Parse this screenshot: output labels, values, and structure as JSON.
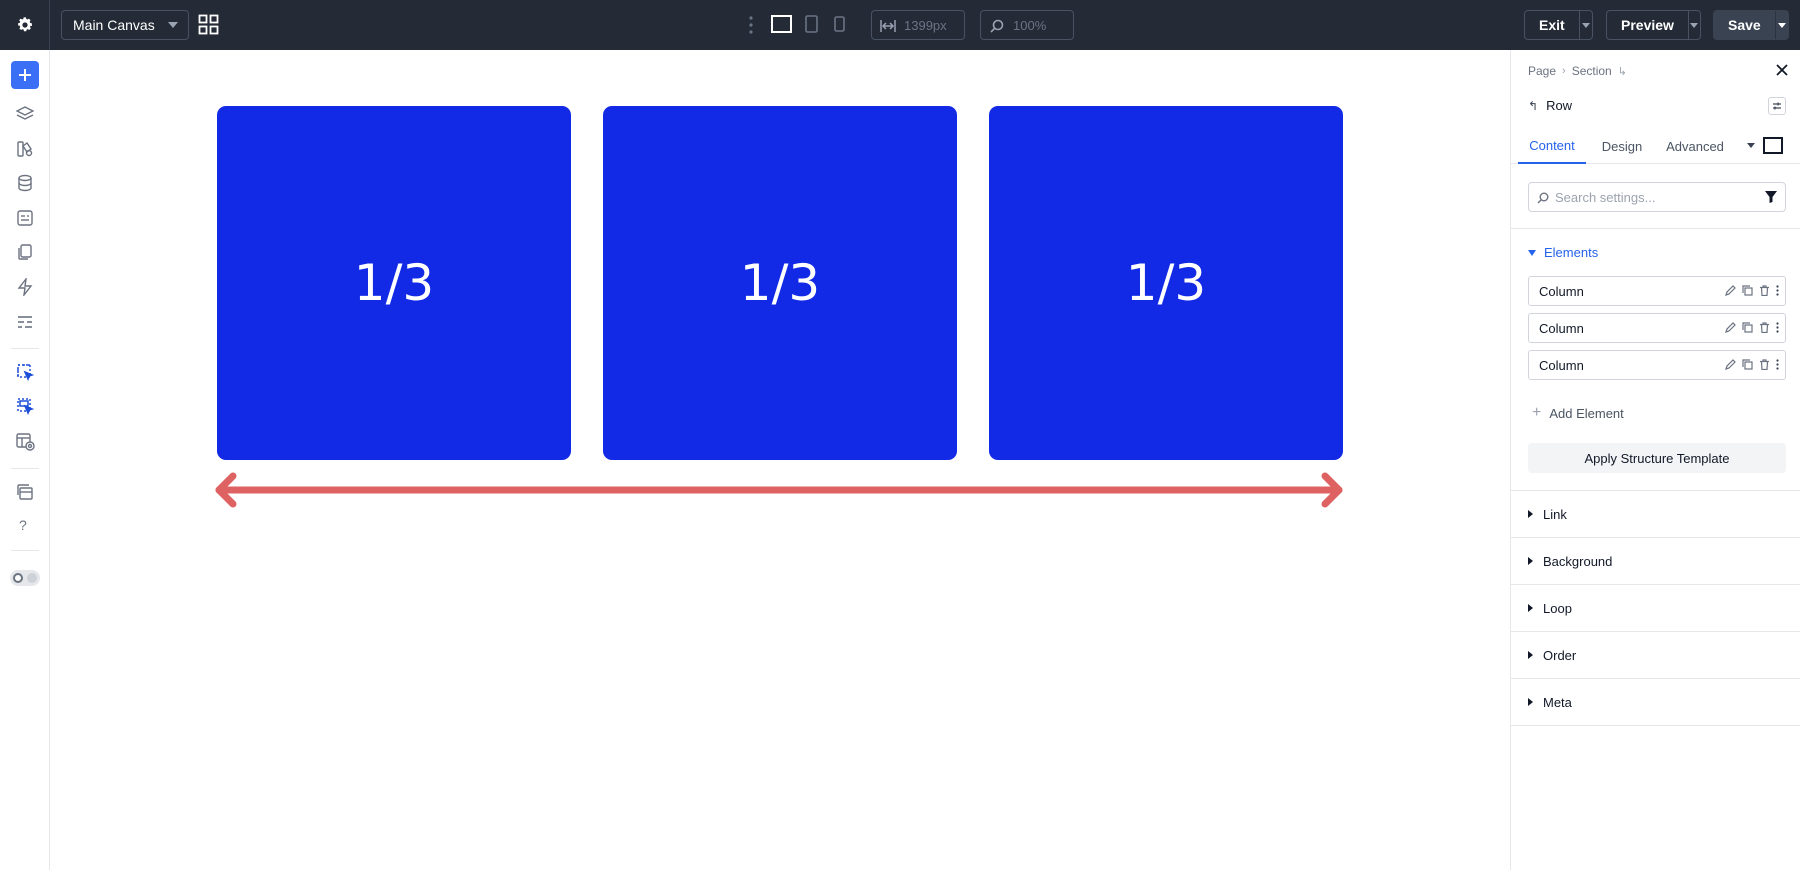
{
  "toolbar": {
    "canvas_select": "Main Canvas",
    "width_value": "1399px",
    "zoom_value": "100%",
    "exit_label": "Exit",
    "preview_label": "Preview",
    "save_label": "Save"
  },
  "canvas": {
    "columns": [
      {
        "label": "1/3"
      },
      {
        "label": "1/3"
      },
      {
        "label": "1/3"
      }
    ],
    "column_color": "#1229e6",
    "arrow_color": "#de6262"
  },
  "panel": {
    "breadcrumb": {
      "page": "Page",
      "section": "Section"
    },
    "title": "Row",
    "tabs": {
      "content": "Content",
      "design": "Design",
      "advanced": "Advanced"
    },
    "search_placeholder": "Search settings...",
    "elements": {
      "heading": "Elements",
      "items": [
        {
          "label": "Column"
        },
        {
          "label": "Column"
        },
        {
          "label": "Column"
        }
      ],
      "add_label": "Add Element",
      "apply_label": "Apply Structure Template"
    },
    "sections": [
      "Link",
      "Background",
      "Loop",
      "Order",
      "Meta"
    ],
    "accent": "#2563eb"
  }
}
